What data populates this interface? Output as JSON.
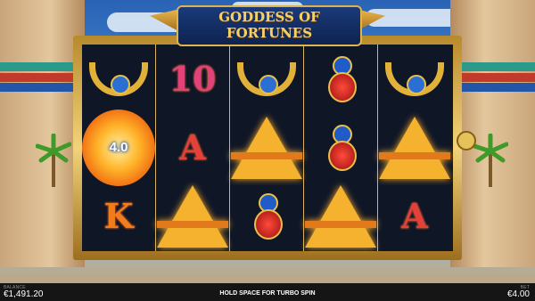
{
  "game": {
    "title_line1": "GODDESS OF",
    "title_line2": "FORTUNES"
  },
  "reels": [
    [
      {
        "symbol": "collar",
        "label": ""
      },
      {
        "symbol": "sun-multiplier",
        "label": "4.0"
      },
      {
        "symbol": "letter",
        "label": "K"
      }
    ],
    [
      {
        "symbol": "letter",
        "label": "10"
      },
      {
        "symbol": "letter",
        "label": "A"
      },
      {
        "symbol": "pyramid",
        "label": ""
      }
    ],
    [
      {
        "symbol": "collar",
        "label": ""
      },
      {
        "symbol": "pyramid",
        "label": ""
      },
      {
        "symbol": "scarab",
        "label": ""
      }
    ],
    [
      {
        "symbol": "scarab",
        "label": ""
      },
      {
        "symbol": "scarab",
        "label": ""
      },
      {
        "symbol": "pyramid",
        "label": ""
      }
    ],
    [
      {
        "symbol": "collar",
        "label": ""
      },
      {
        "symbol": "pyramid",
        "label": ""
      },
      {
        "symbol": "letter",
        "label": "A"
      }
    ]
  ],
  "footer": {
    "balance_label": "BALANCE",
    "balance_value": "€1,491.20",
    "hint": "HOLD SPACE FOR TURBO SPIN",
    "bet_label": "BET",
    "bet_value": "€4.00"
  },
  "colors": {
    "frame_gold": "#e0b44a",
    "reel_bg": "#0f1626",
    "letter_red": "#e5403a",
    "ten_pink": "#e2427a"
  }
}
